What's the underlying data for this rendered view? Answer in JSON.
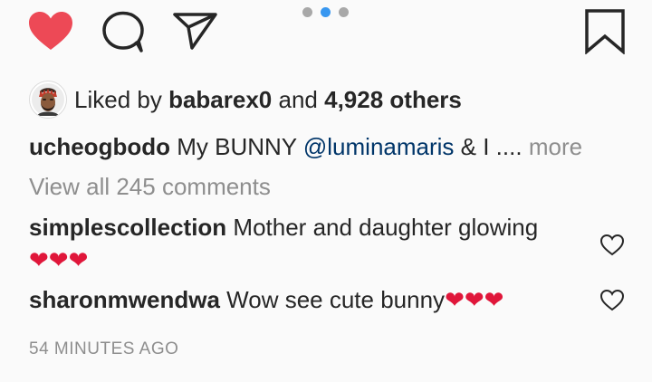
{
  "actions": {
    "like_icon": "heart-filled-icon",
    "comment_icon": "comment-icon",
    "share_icon": "send-icon",
    "save_icon": "bookmark-icon",
    "like_color": "#ed4956"
  },
  "carousel": {
    "count": 3,
    "active_index": 1
  },
  "likes": {
    "prefix": "Liked by",
    "user": "babarex0",
    "connector": "and",
    "count": "4,928 others"
  },
  "caption": {
    "username": "ucheogbodo",
    "text_before": "My BUNNY",
    "mention": "@luminamaris",
    "text_after": "& I ....",
    "more": "more"
  },
  "view_comments": "View all 245 comments",
  "comments": [
    {
      "username": "simplescollection",
      "text": "Mother and daughter glowing",
      "emoji": "❤❤❤"
    },
    {
      "username": "sharonmwendwa",
      "text": "Wow see cute bunny",
      "emoji": "❤❤❤"
    }
  ],
  "timestamp": "54 MINUTES AGO"
}
